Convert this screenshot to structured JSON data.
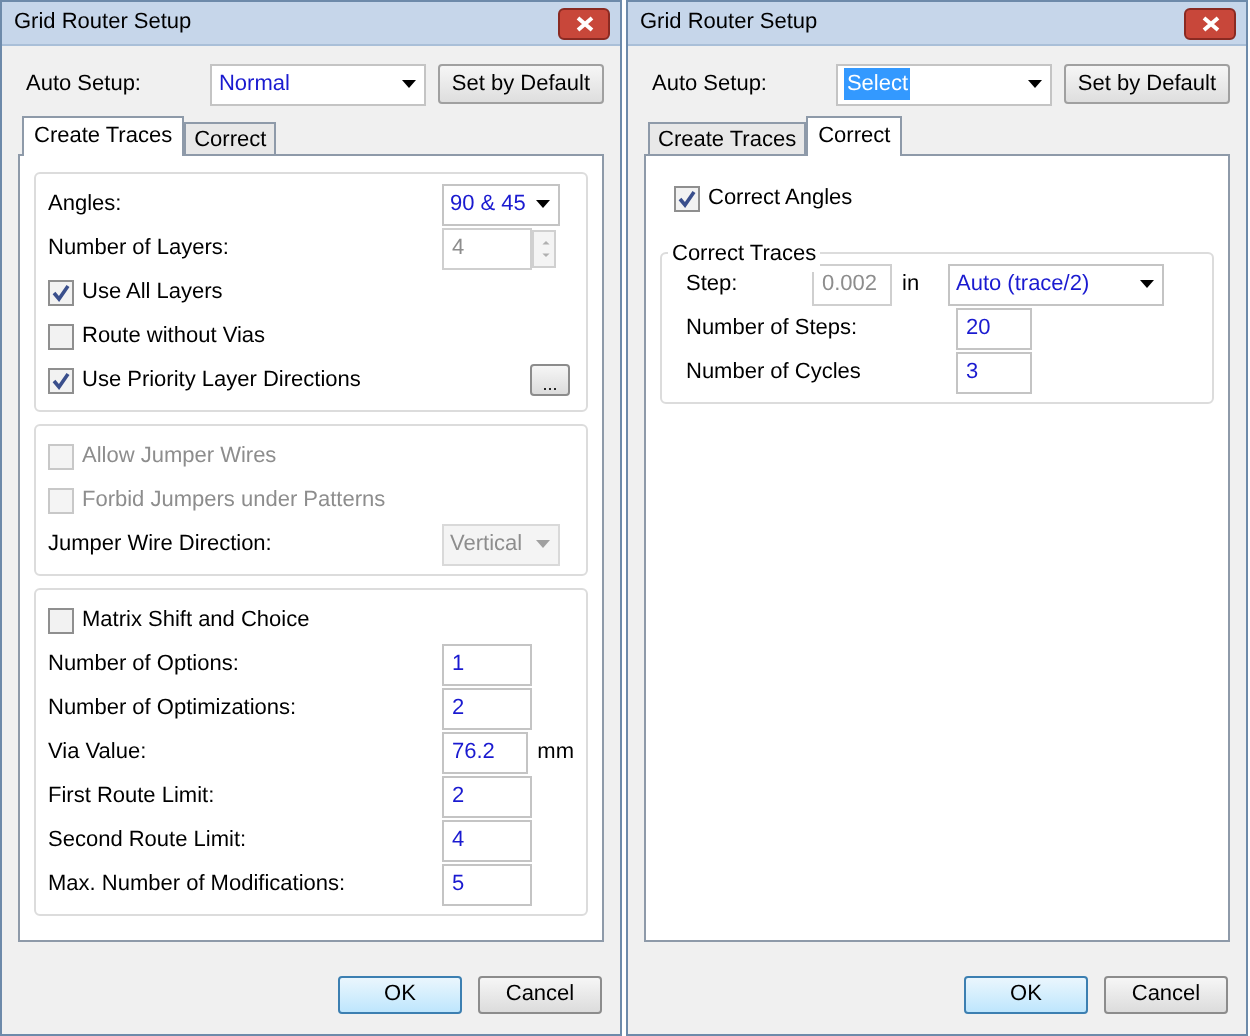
{
  "dialogs": [
    {
      "title": "Grid Router Setup",
      "auto_setup": {
        "label": "Auto Setup:",
        "value": "Normal",
        "highlighted": false
      },
      "default_button": "Set by Default",
      "tabs": [
        {
          "label": "Create Traces",
          "selected": true
        },
        {
          "label": "Correct",
          "selected": false
        }
      ],
      "panel": {
        "kind": "create",
        "groups": [
          {
            "rows": [
              {
                "kind": "dropdown",
                "label": "Angles:",
                "value": "90 & 45",
                "disabled": false
              },
              {
                "kind": "spinner",
                "label": "Number of Layers:",
                "value": "4",
                "disabled": true
              },
              {
                "kind": "checkbox",
                "label": "Use All Layers",
                "checked": true,
                "disabled": false
              },
              {
                "kind": "checkbox",
                "label": "Route without Vias",
                "checked": false,
                "disabled": false
              },
              {
                "kind": "checkbox",
                "label": "Use Priority Layer Directions",
                "checked": true,
                "disabled": false,
                "button": "..."
              }
            ]
          },
          {
            "rows": [
              {
                "kind": "checkbox",
                "label": "Allow Jumper Wires",
                "checked": false,
                "disabled": true
              },
              {
                "kind": "checkbox",
                "label": "Forbid Jumpers under Patterns",
                "checked": false,
                "disabled": true
              },
              {
                "kind": "dropdown",
                "label": "Jumper Wire Direction:",
                "value": "Vertical",
                "disabled": true
              }
            ]
          },
          {
            "rows": [
              {
                "kind": "checkbox",
                "label": "Matrix Shift and Choice",
                "checked": false,
                "disabled": false
              },
              {
                "kind": "field",
                "label": "Number of Options:",
                "value": "1"
              },
              {
                "kind": "field",
                "label": "Number of Optimizations:",
                "value": "2"
              },
              {
                "kind": "field",
                "label": "Via Value:",
                "value": "76.2",
                "unit": "mm"
              },
              {
                "kind": "field",
                "label": "First Route Limit:",
                "value": "2"
              },
              {
                "kind": "field",
                "label": "Second Route Limit:",
                "value": "4"
              },
              {
                "kind": "field",
                "label": "Max. Number of Modifications:",
                "value": "5"
              }
            ]
          }
        ]
      },
      "buttons": [
        {
          "label": "OK",
          "default": true
        },
        {
          "label": "Cancel",
          "default": false
        }
      ]
    },
    {
      "title": "Grid Router Setup",
      "auto_setup": {
        "label": "Auto Setup:",
        "value": "Select",
        "highlighted": true
      },
      "default_button": "Set by Default",
      "tabs": [
        {
          "label": "Create Traces",
          "selected": false
        },
        {
          "label": "Correct",
          "selected": true
        }
      ],
      "panel": {
        "kind": "correct",
        "rows": [
          {
            "kind": "checkbox",
            "label": "Correct Angles",
            "checked": true,
            "disabled": false
          }
        ],
        "groups": [
          {
            "legend": "Correct Traces",
            "rows": [
              {
                "kind": "step",
                "label": "Step:",
                "value": "0.002",
                "unit": "in",
                "option": "Auto (trace/2)"
              },
              {
                "kind": "field",
                "label": "Number of Steps:",
                "value": "20"
              },
              {
                "kind": "field",
                "label": "Number of Cycles",
                "value": "3"
              }
            ]
          }
        ]
      },
      "buttons": [
        {
          "label": "OK",
          "default": true
        },
        {
          "label": "Cancel",
          "default": false
        }
      ]
    }
  ]
}
